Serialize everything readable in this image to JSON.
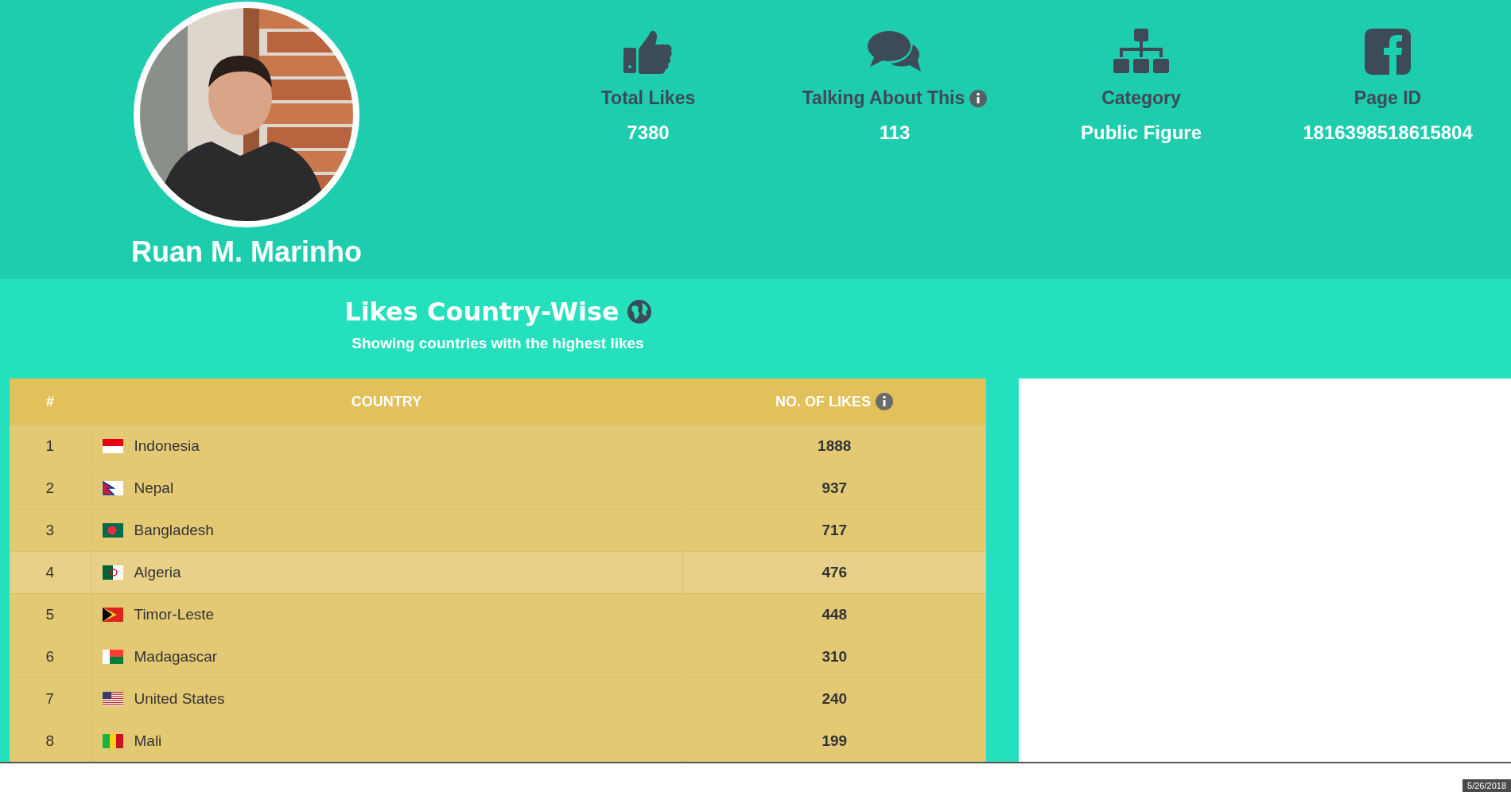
{
  "profile": {
    "name": "Ruan M. Marinho"
  },
  "stats": [
    {
      "label": "Total Likes",
      "value": "7380",
      "info": false
    },
    {
      "label": "Talking About This",
      "value": "113",
      "info": true
    },
    {
      "label": "Category",
      "value": "Public Figure",
      "info": false
    },
    {
      "label": "Page ID",
      "value": "1816398518615804",
      "info": false
    }
  ],
  "section": {
    "title": "Likes Country-Wise",
    "subtitle": "Showing countries with the highest likes"
  },
  "table": {
    "columns": [
      {
        "label": "#",
        "info": false
      },
      {
        "label": "COUNTRY",
        "info": false
      },
      {
        "label": "NO. OF LIKES",
        "info": true
      }
    ],
    "rows": [
      {
        "rank": "1",
        "country": "Indonesia",
        "likes": "1888",
        "highlighted": false,
        "flag": {
          "kind": "bicolor"
        }
      },
      {
        "rank": "2",
        "country": "Nepal",
        "likes": "937",
        "highlighted": false,
        "flag": {
          "kind": "pennant"
        }
      },
      {
        "rank": "3",
        "country": "Bangladesh",
        "likes": "717",
        "highlighted": false,
        "flag": {
          "kind": "disc"
        }
      },
      {
        "rank": "4",
        "country": "Algeria",
        "likes": "476",
        "highlighted": true,
        "flag": {
          "kind": "crescent"
        }
      },
      {
        "rank": "5",
        "country": "Timor-Leste",
        "likes": "448",
        "highlighted": false,
        "flag": {
          "kind": "chevron"
        }
      },
      {
        "rank": "6",
        "country": "Madagascar",
        "likes": "310",
        "highlighted": false,
        "flag": {
          "kind": "split"
        }
      },
      {
        "rank": "7",
        "country": "United States",
        "likes": "240",
        "highlighted": false,
        "flag": {
          "kind": "stripes"
        }
      },
      {
        "rank": "8",
        "country": "Mali",
        "likes": "199",
        "highlighted": false,
        "flag": {
          "kind": "tricolor"
        }
      }
    ]
  },
  "status_bar": {
    "date": "5/26/2018"
  }
}
